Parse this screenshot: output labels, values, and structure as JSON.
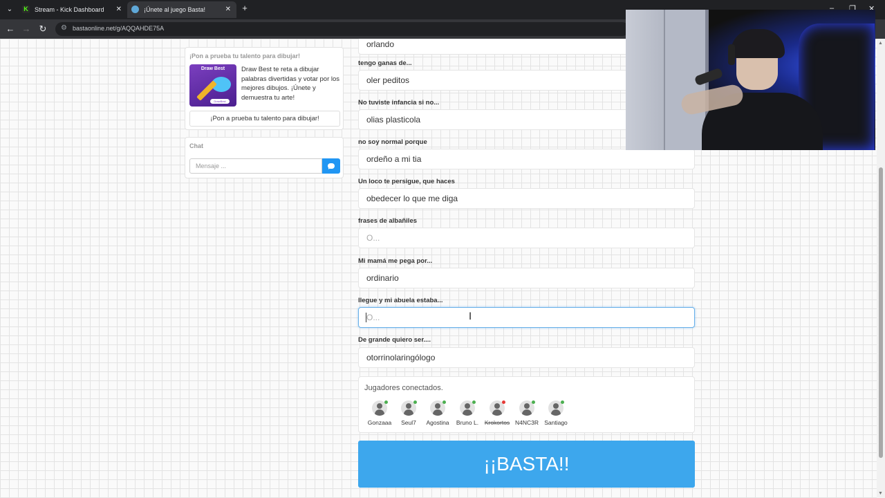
{
  "browser": {
    "tabs": [
      {
        "title": "Stream - Kick Dashboard",
        "active": false,
        "icon": "kick-icon"
      },
      {
        "title": "¡Únete al juego Basta!",
        "active": true,
        "icon": "basta-icon"
      }
    ],
    "url": "bastaonline.net/g/AQQAHDE75A"
  },
  "sidebar": {
    "promo": {
      "heading": "¡Pon a prueba tu talento para dibujar!",
      "image_title": "Draw Best",
      "image_badge": "DrawBest",
      "description": "Draw Best te reta a dibujar palabras divertidas y votar por los mejores dibujos. ¡Únete y demuestra tu arte!",
      "button_label": "¡Pon a prueba tu talento para dibujar!"
    },
    "chat": {
      "heading": "Chat",
      "placeholder": "Mensaje ..."
    }
  },
  "form": {
    "fields": [
      {
        "label": "",
        "value": "orlando",
        "placeholder": ""
      },
      {
        "label": "tengo ganas de...",
        "value": "oler peditos",
        "placeholder": ""
      },
      {
        "label": "No tuviste infancia si no...",
        "value": "olias plasticola",
        "placeholder": ""
      },
      {
        "label": "no soy normal porque",
        "value": "ordeño a mi tia",
        "placeholder": ""
      },
      {
        "label": "Un loco te persigue, que haces",
        "value": "obedecer lo que me diga",
        "placeholder": ""
      },
      {
        "label": "frases de albañiles",
        "value": "",
        "placeholder": "O..."
      },
      {
        "label": "Mi mamá me pega por...",
        "value": "ordinario",
        "placeholder": ""
      },
      {
        "label": "llegue y mi abuela estaba...",
        "value": "",
        "placeholder": "O..."
      },
      {
        "label": "De grande quiero ser....",
        "value": "otorrinolaringólogo",
        "placeholder": ""
      }
    ],
    "focused_field_index": 7
  },
  "players": {
    "heading": "Jugadores conectados.",
    "list": [
      {
        "name": "Gonzaaa",
        "status": "online"
      },
      {
        "name": "Seul7",
        "status": "online"
      },
      {
        "name": "Agostina",
        "status": "online"
      },
      {
        "name": "Bruno L.",
        "status": "online"
      },
      {
        "name": "Krokortos",
        "status": "offline"
      },
      {
        "name": "N4NC3R",
        "status": "online"
      },
      {
        "name": "Santiago",
        "status": "online"
      }
    ]
  },
  "basta_button": "¡¡BASTA!!",
  "colors": {
    "accent": "#3da7ed",
    "online": "#4caf50",
    "offline": "#e53935",
    "focus_border": "#66afe9"
  }
}
